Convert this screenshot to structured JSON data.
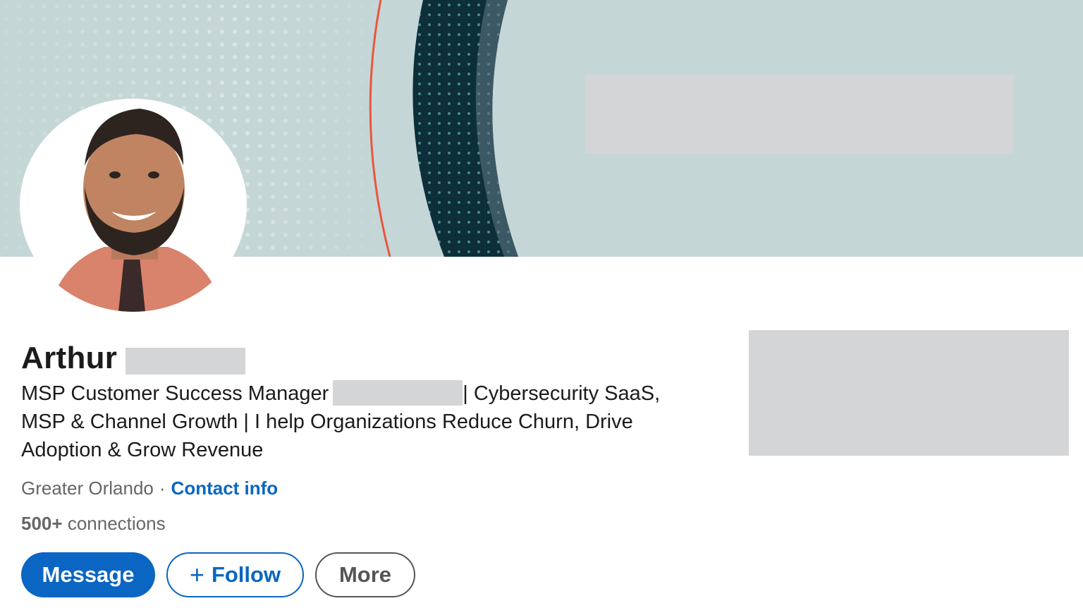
{
  "profile": {
    "name_visible": "Arthur",
    "headline_part1": "MSP Customer Success Manager",
    "headline_part2": "| Cybersecurity SaaS, MSP & Channel Growth | I help Organizations Reduce Churn, Drive Adoption & Grow Revenue",
    "location": "Greater Orlando",
    "separator": "·",
    "contact_info_label": "Contact info",
    "connections_count": "500+",
    "connections_label": "connections"
  },
  "actions": {
    "message_label": "Message",
    "follow_plus": "+",
    "follow_label": "Follow",
    "more_label": "More"
  },
  "colors": {
    "banner": "#c5d6d7",
    "accent_blue": "#0a66c2",
    "redaction_gray": "#d4d5d7",
    "banner_red_line": "#e8573c",
    "banner_dark_teal": "#0d2f3a"
  },
  "icons": {
    "follow": "plus-icon"
  }
}
